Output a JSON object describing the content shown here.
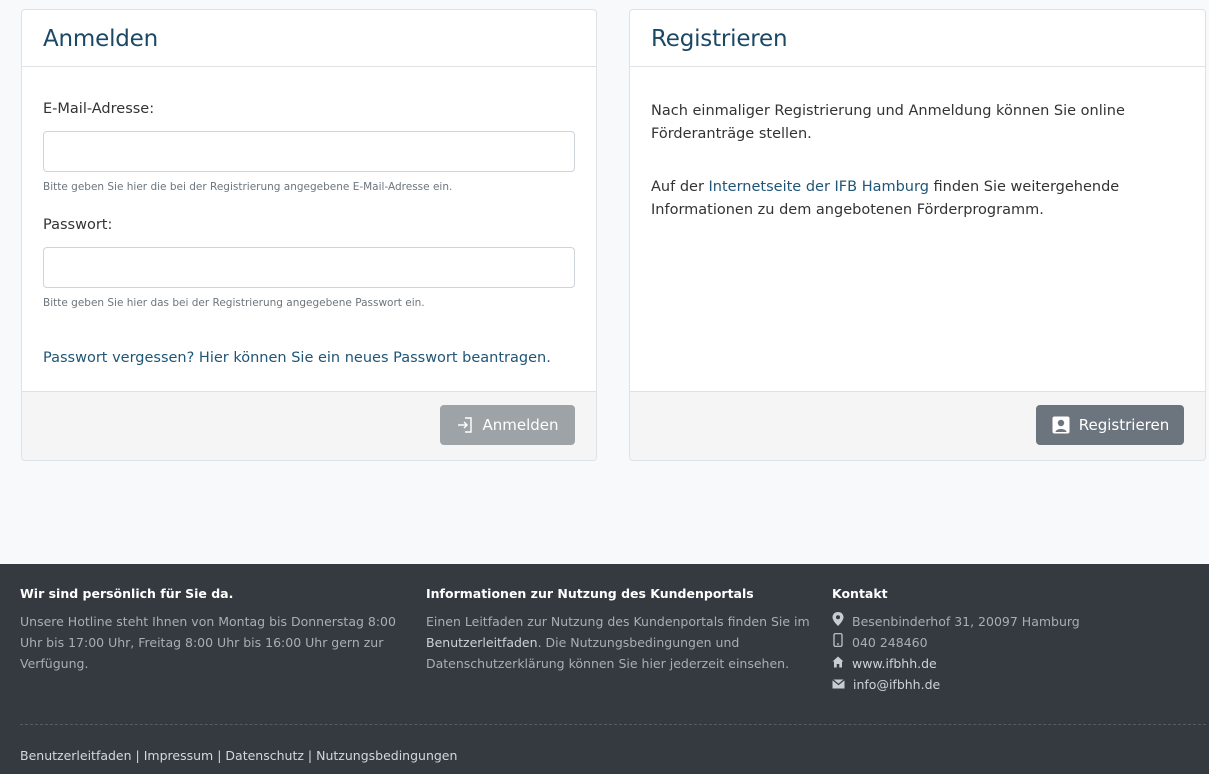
{
  "login": {
    "title": "Anmelden",
    "email_label": "E-Mail-Adresse:",
    "email_value": "",
    "email_help": "Bitte geben Sie hier die bei der Registrierung angegebene E-Mail-Adresse ein.",
    "password_label": "Passwort:",
    "password_value": "",
    "password_help": "Bitte geben Sie hier das bei der Registrierung angegebene Passwort ein.",
    "forgot_link": "Passwort vergessen? Hier können Sie ein neues Passwort beantragen.",
    "submit_label": "Anmelden",
    "submit_icon": "sign-in-icon"
  },
  "register": {
    "title": "Registrieren",
    "para1": "Nach einmaliger Registrierung und Anmeldung können Sie online Förderanträge stellen.",
    "para2_before": "Auf der ",
    "para2_link": "Internetseite der IFB Hamburg",
    "para2_after": " finden Sie weitergehende Informationen zu dem angebotenen Förderprogramm.",
    "submit_label": "Registrieren",
    "submit_icon": "user-square-icon"
  },
  "footer": {
    "col1": {
      "heading": "Wir sind persönlich für Sie da.",
      "text": "Unsere Hotline steht Ihnen von Montag bis Donnerstag 8:00 Uhr bis 17:00 Uhr, Freitag 8:00 Uhr bis 16:00 Uhr gern zur Verfügung."
    },
    "col2": {
      "heading": "Informationen zur Nutzung des Kundenportals",
      "text_before": "Einen Leitfaden zur Nutzung des Kundenportals finden Sie im ",
      "link": "Benutzerleitfaden",
      "text_after": ". Die Nutzungsbedingungen und Datenschutzerklärung können Sie hier jederzeit einsehen."
    },
    "col3": {
      "heading": "Kontakt",
      "address": "Besenbinderhof 31, 20097 Hamburg",
      "phone": "040 248460",
      "website": "www.ifbhh.de",
      "email": "info@ifbhh.de",
      "icons": [
        "map-marker-icon",
        "phone-icon",
        "home-icon",
        "envelope-icon"
      ]
    },
    "links": [
      "Benutzerleitfaden",
      "Impressum",
      "Datenschutz",
      "Nutzungsbedingungen"
    ],
    "separator": "|"
  },
  "colors": {
    "title": "#1b4965",
    "link": "#1f5577",
    "login_button": "#9ea3a8",
    "register_button": "#6c757d",
    "footer_bg": "#343a40"
  }
}
